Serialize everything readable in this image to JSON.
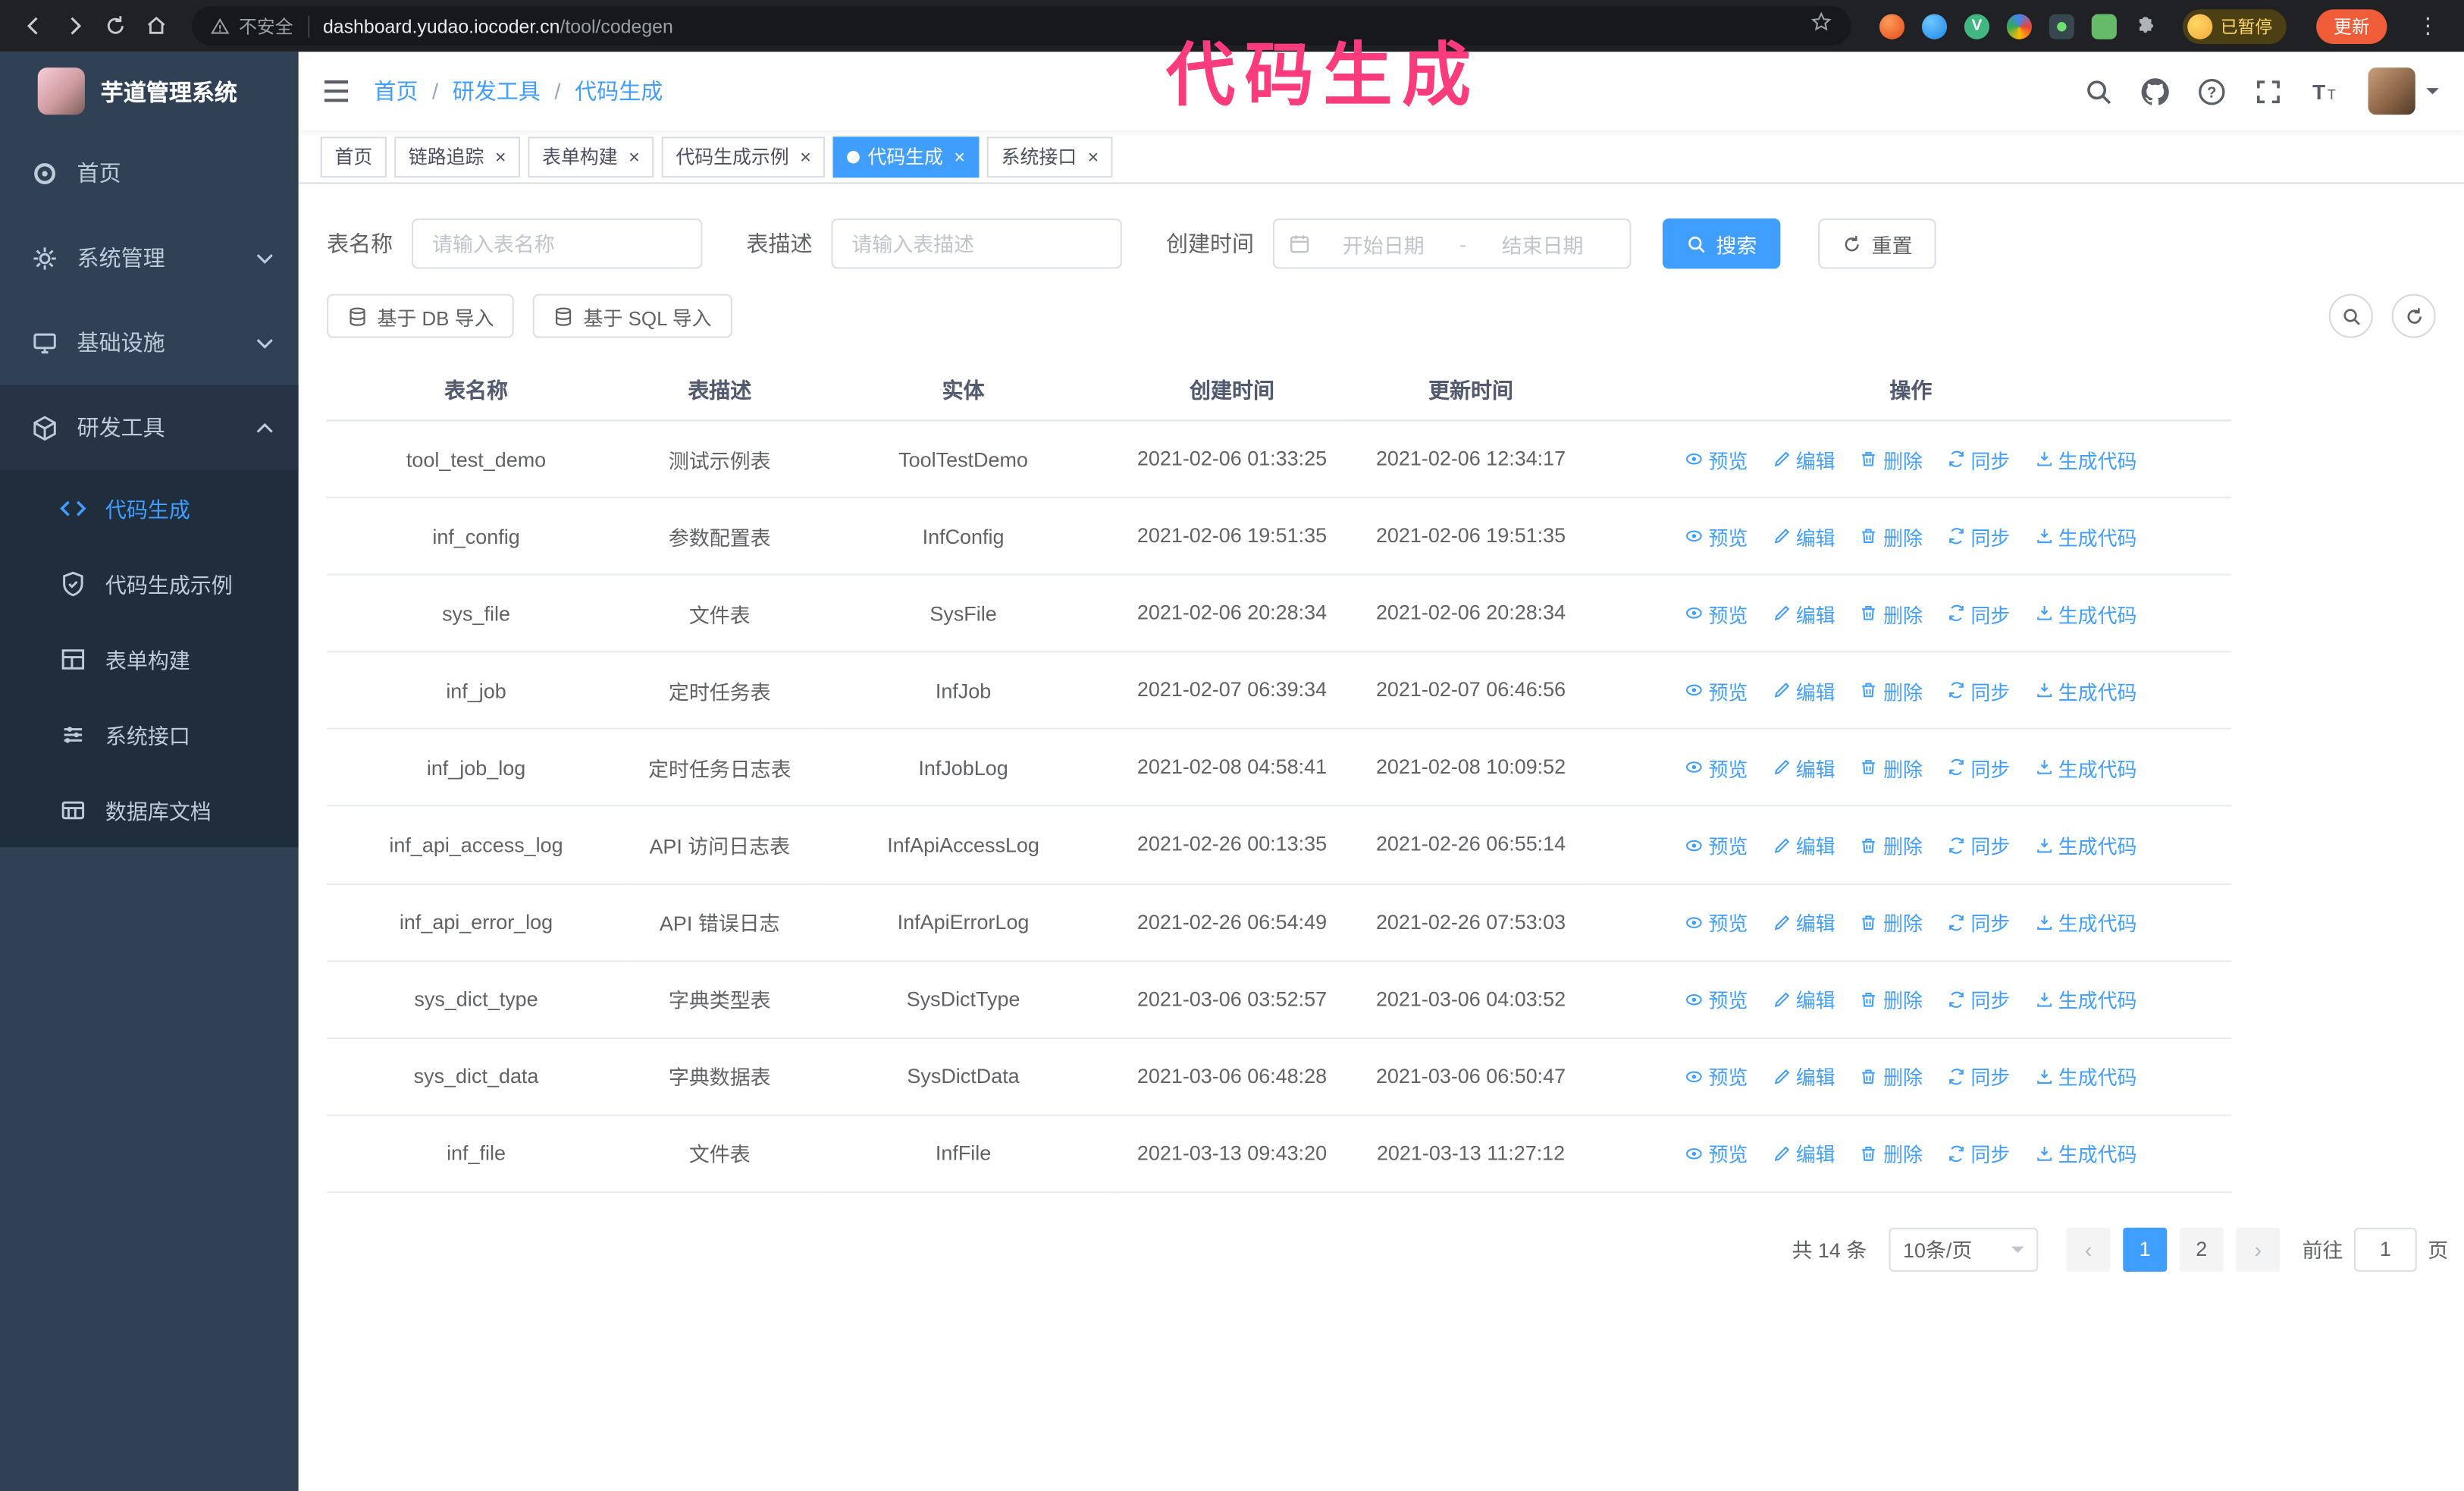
{
  "annotation": {
    "text": "代码生成"
  },
  "browser": {
    "security_text": "不安全",
    "url_host": "dashboard.yudao.iocoder.cn",
    "url_path": "/tool/codegen",
    "profile_badge": "已暂停",
    "update_button": "更新"
  },
  "sidebar": {
    "logo_title": "芋道管理系统",
    "items": [
      {
        "label": "首页"
      },
      {
        "label": "系统管理"
      },
      {
        "label": "基础设施"
      },
      {
        "label": "研发工具"
      }
    ],
    "sub_items": [
      {
        "label": "代码生成",
        "active": true
      },
      {
        "label": "代码生成示例"
      },
      {
        "label": "表单构建"
      },
      {
        "label": "系统接口"
      },
      {
        "label": "数据库文档"
      }
    ]
  },
  "header": {
    "breadcrumb": [
      "首页",
      "研发工具",
      "代码生成"
    ],
    "icons": [
      "search",
      "github",
      "help",
      "fullscreen",
      "font-size",
      "avatar"
    ]
  },
  "tabs": [
    {
      "label": "首页",
      "closable": false
    },
    {
      "label": "链路追踪",
      "closable": true
    },
    {
      "label": "表单构建",
      "closable": true
    },
    {
      "label": "代码生成示例",
      "closable": true
    },
    {
      "label": "代码生成",
      "closable": true,
      "active": true
    },
    {
      "label": "系统接口",
      "closable": true
    }
  ],
  "filters": {
    "table_name_label": "表名称",
    "table_name_placeholder": "请输入表名称",
    "table_desc_label": "表描述",
    "table_desc_placeholder": "请输入表描述",
    "create_time_label": "创建时间",
    "date_start_placeholder": "开始日期",
    "date_separator": "-",
    "date_end_placeholder": "结束日期",
    "search_button": "搜索",
    "reset_button": "重置"
  },
  "toolbar": {
    "import_db_button": "基于 DB 导入",
    "import_sql_button": "基于 SQL 导入"
  },
  "table": {
    "columns": [
      "表名称",
      "表描述",
      "实体",
      "创建时间",
      "更新时间",
      "操作"
    ],
    "actions": [
      "预览",
      "编辑",
      "删除",
      "同步",
      "生成代码"
    ],
    "rows": [
      {
        "name": "tool_test_demo",
        "desc": "测试示例表",
        "entity": "ToolTestDemo",
        "created": "2021-02-06 01:33:25",
        "updated": "2021-02-06 12:34:17"
      },
      {
        "name": "inf_config",
        "desc": "参数配置表",
        "entity": "InfConfig",
        "created": "2021-02-06 19:51:35",
        "updated": "2021-02-06 19:51:35"
      },
      {
        "name": "sys_file",
        "desc": "文件表",
        "entity": "SysFile",
        "created": "2021-02-06 20:28:34",
        "updated": "2021-02-06 20:28:34"
      },
      {
        "name": "inf_job",
        "desc": "定时任务表",
        "entity": "InfJob",
        "created": "2021-02-07 06:39:34",
        "updated": "2021-02-07 06:46:56"
      },
      {
        "name": "inf_job_log",
        "desc": "定时任务日志表",
        "entity": "InfJobLog",
        "created": "2021-02-08 04:58:41",
        "updated": "2021-02-08 10:09:52"
      },
      {
        "name": "inf_api_access_log",
        "desc": "API 访问日志表",
        "entity": "InfApiAccessLog",
        "created": "2021-02-26 00:13:35",
        "updated": "2021-02-26 06:55:14"
      },
      {
        "name": "inf_api_error_log",
        "desc": "API 错误日志",
        "entity": "InfApiErrorLog",
        "created": "2021-02-26 06:54:49",
        "updated": "2021-02-26 07:53:03"
      },
      {
        "name": "sys_dict_type",
        "desc": "字典类型表",
        "entity": "SysDictType",
        "created": "2021-03-06 03:52:57",
        "updated": "2021-03-06 04:03:52"
      },
      {
        "name": "sys_dict_data",
        "desc": "字典数据表",
        "entity": "SysDictData",
        "created": "2021-03-06 06:48:28",
        "updated": "2021-03-06 06:50:47"
      },
      {
        "name": "inf_file",
        "desc": "文件表",
        "entity": "InfFile",
        "created": "2021-03-13 09:43:20",
        "updated": "2021-03-13 11:27:12"
      }
    ]
  },
  "pagination": {
    "total_text": "共 14 条",
    "page_size": "10条/页",
    "prev": "‹",
    "next": "›",
    "pages": [
      "1",
      "2"
    ],
    "active_page": "1",
    "goto_label": "前往",
    "goto_value": "1",
    "page_suffix": "页"
  },
  "colors": {
    "primary": "#409eff",
    "sidebar_bg": "#304156",
    "submenu_bg": "#1f2d3d",
    "annotation": "#fb3b7c",
    "update_button_bg": "#ee5d38",
    "paused_text": "#fdd663"
  }
}
